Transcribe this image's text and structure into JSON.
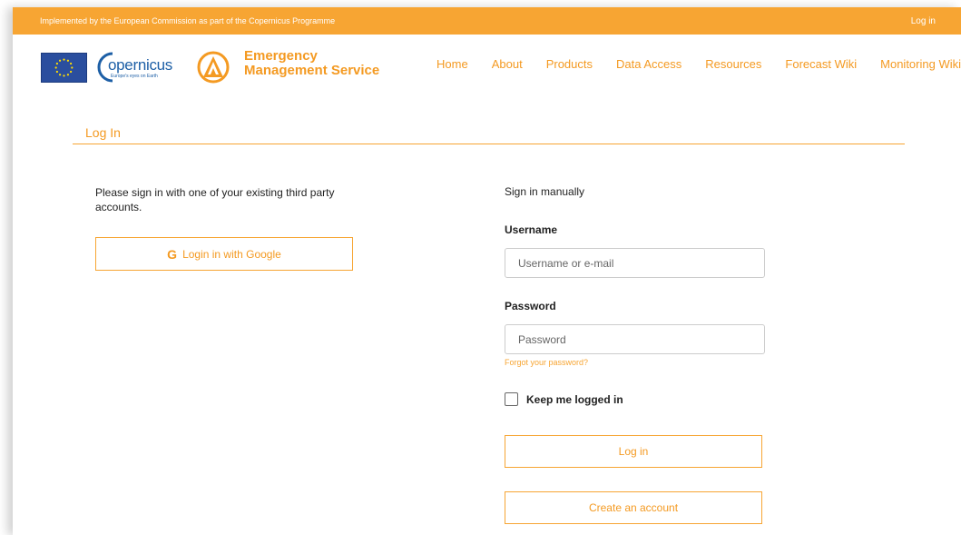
{
  "topbar": {
    "notice": "Implemented by the European Commission as part of the Copernicus Programme",
    "login_link": "Log in"
  },
  "header": {
    "copernicus_word": "opernicus",
    "copernicus_tagline": "Europe's eyes on Earth",
    "ems_title_line1": "Emergency",
    "ems_title_line2": "Management Service"
  },
  "nav": {
    "items": [
      "Home",
      "About",
      "Products",
      "Data Access",
      "Resources",
      "Forecast Wiki",
      "Monitoring Wiki"
    ]
  },
  "page": {
    "title": "Log In"
  },
  "third_party": {
    "intro": "Please sign in with one of your existing third party accounts.",
    "google_icon": "G",
    "google_label": "Login in with Google"
  },
  "manual": {
    "heading": "Sign in manually",
    "username_label": "Username",
    "username_placeholder": "Username or e-mail",
    "password_label": "Password",
    "password_placeholder": "Password",
    "forgot_link": "Forgot your password?",
    "keep_label": "Keep me logged in",
    "login_button": "Log in",
    "create_button": "Create an account"
  },
  "colors": {
    "accent": "#f7a533",
    "accent_text": "#f49a22",
    "eu_blue": "#2a4e9e",
    "copernicus_blue": "#1d5fa6"
  }
}
